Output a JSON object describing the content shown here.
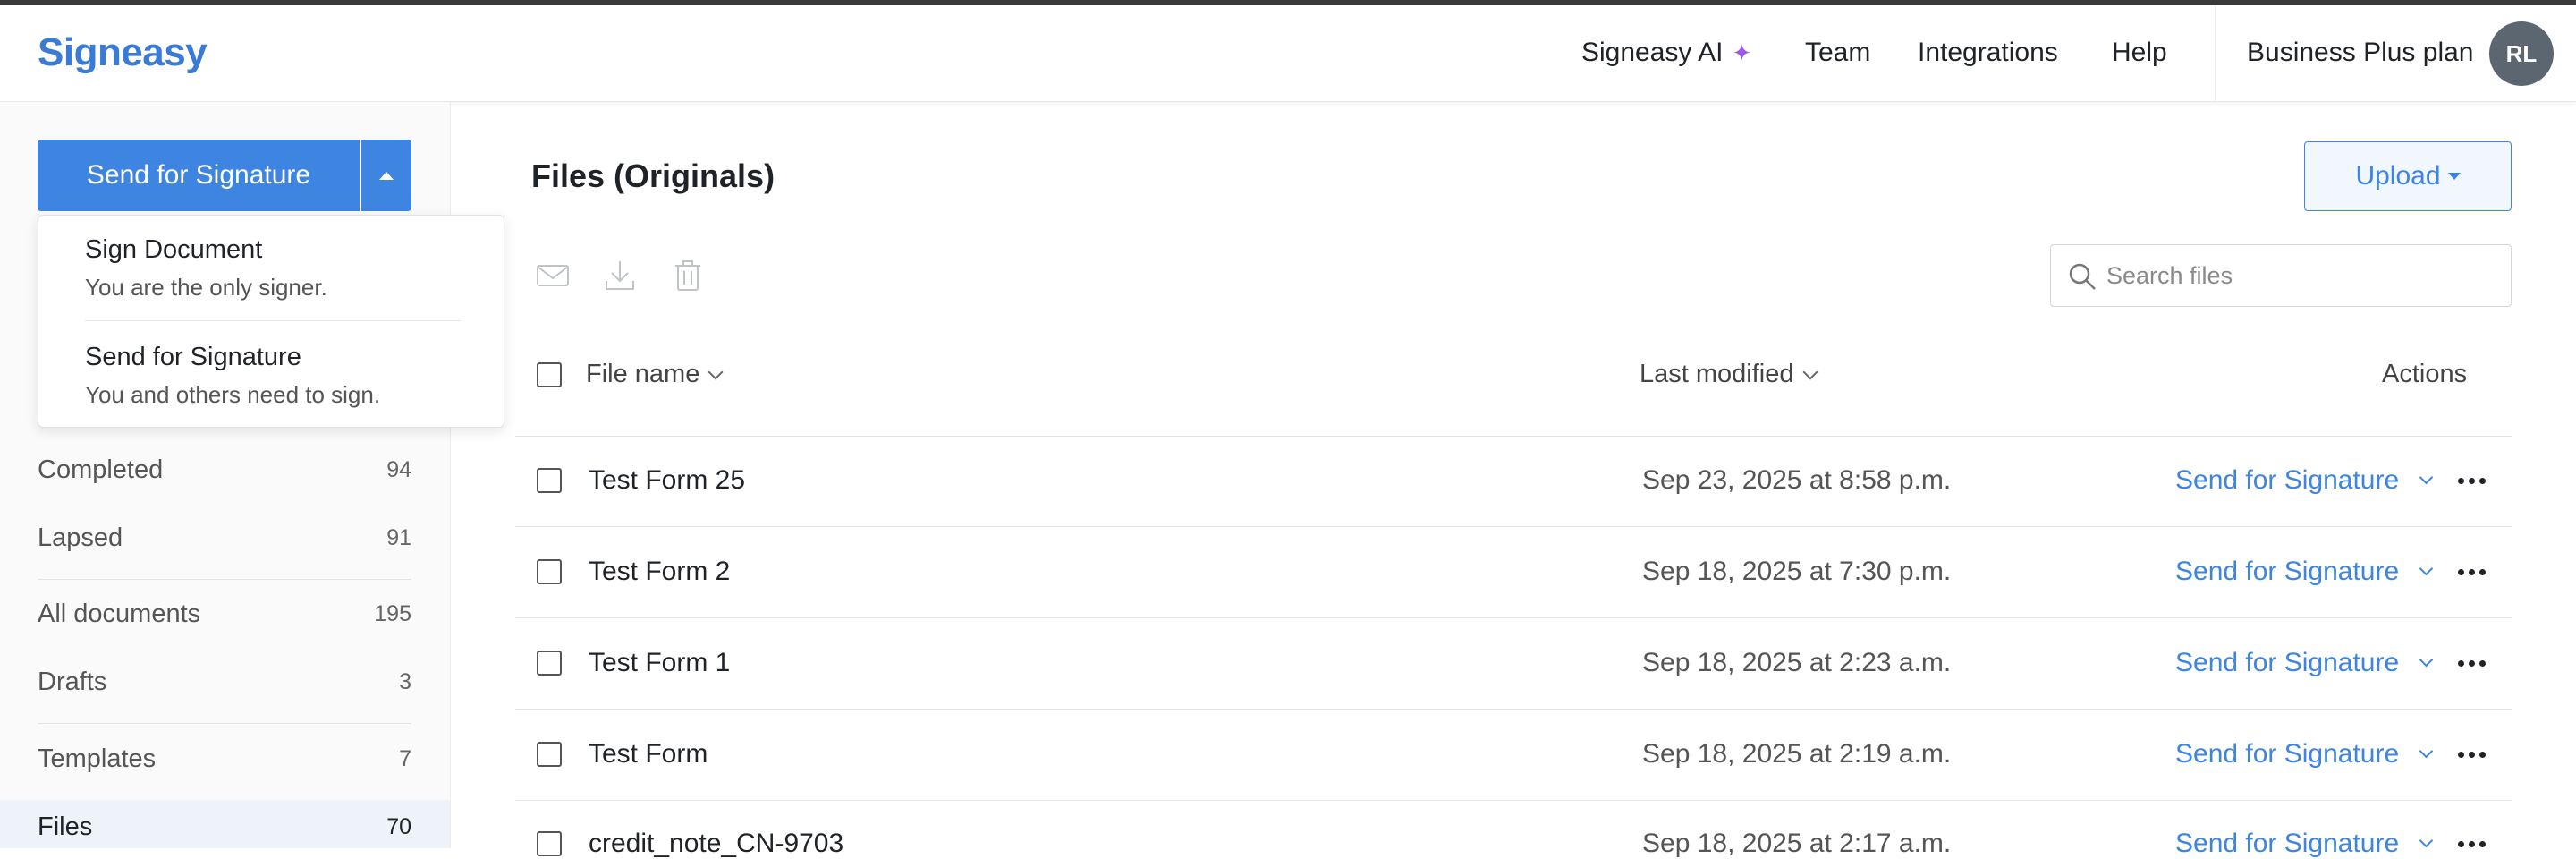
{
  "header": {
    "logo": "Signeasy",
    "nav": {
      "ai": "Signeasy AI",
      "team": "Team",
      "integrations": "Integrations",
      "help": "Help"
    },
    "plan": "Business Plus plan",
    "avatar_initials": "RL"
  },
  "sidebar": {
    "send_button_label": "Send for Signature",
    "dropdown": [
      {
        "title": "Sign Document",
        "subtitle": "You are the only signer."
      },
      {
        "title": "Send for Signature",
        "subtitle": "You and others need to sign."
      }
    ],
    "items": [
      {
        "label": "Completed",
        "count": "94"
      },
      {
        "label": "Lapsed",
        "count": "91"
      },
      {
        "label": "All documents",
        "count": "195"
      },
      {
        "label": "Drafts",
        "count": "3"
      },
      {
        "label": "Templates",
        "count": "7"
      },
      {
        "label": "Files",
        "count": "70"
      }
    ]
  },
  "main": {
    "title": "Files (Originals)",
    "upload_label": "Upload",
    "search_placeholder": "Search files",
    "columns": {
      "name": "File name",
      "modified": "Last modified",
      "actions": "Actions"
    },
    "rows": [
      {
        "name": "Test Form 25",
        "modified": "Sep 23, 2025 at 8:58 p.m.",
        "action": "Send for Signature"
      },
      {
        "name": "Test Form 2",
        "modified": "Sep 18, 2025 at 7:30 p.m.",
        "action": "Send for Signature"
      },
      {
        "name": "Test Form 1",
        "modified": "Sep 18, 2025 at 2:23 a.m.",
        "action": "Send for Signature"
      },
      {
        "name": "Test Form",
        "modified": "Sep 18, 2025 at 2:19 a.m.",
        "action": "Send for Signature"
      },
      {
        "name": "credit_note_CN-9703",
        "modified": "Sep 18, 2025 at 2:17 a.m.",
        "action": "Send for Signature"
      }
    ]
  },
  "colors": {
    "accent": "#3d85e0",
    "logo": "#3a7bd5",
    "sparkle": "#9b59e6",
    "avatar_bg": "#5b6670"
  }
}
